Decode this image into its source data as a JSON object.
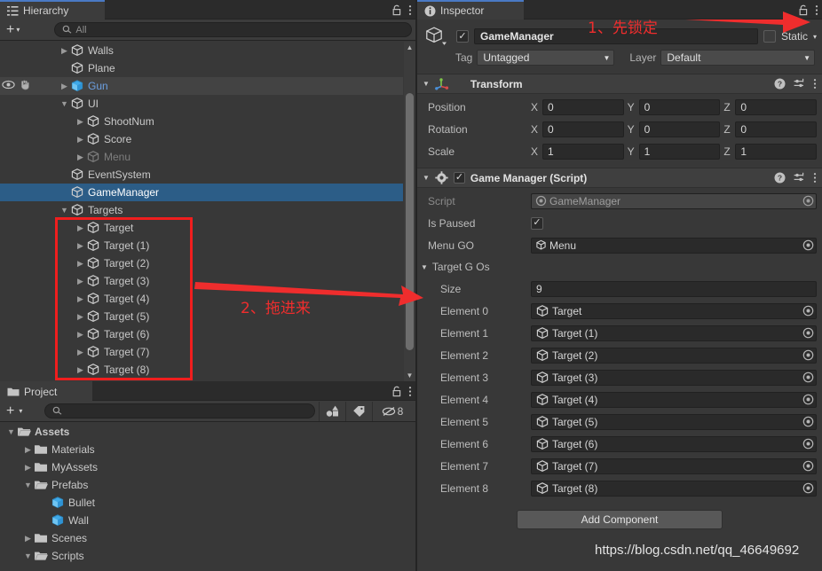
{
  "hierarchy": {
    "tab_label": "Hierarchy",
    "tab_icon": "hierarchy-icon",
    "lock_icon": "lock-icon",
    "menu_icon": "kebab-menu-icon",
    "create_label": "+",
    "create_caret": "▾",
    "search_placeholder": "All",
    "search_value": "",
    "search_icon": "search-icon",
    "items": [
      {
        "label": "Walls",
        "depth": 2,
        "arrow": "▶",
        "state": "normal",
        "icon": "cube-icon"
      },
      {
        "label": "Plane",
        "depth": 2,
        "arrow": "",
        "state": "normal",
        "icon": "cube-icon"
      },
      {
        "label": "Gun",
        "depth": 2,
        "arrow": "▶",
        "state": "hover-prefab",
        "icon": "prefab-cube-icon",
        "eye_icon": "eye-icon",
        "hand_icon": "hand-icon"
      },
      {
        "label": "UI",
        "depth": 2,
        "arrow": "▼",
        "state": "normal",
        "icon": "cube-icon"
      },
      {
        "label": "ShootNum",
        "depth": 3,
        "arrow": "▶",
        "state": "normal",
        "icon": "cube-icon"
      },
      {
        "label": "Score",
        "depth": 3,
        "arrow": "▶",
        "state": "normal",
        "icon": "cube-icon"
      },
      {
        "label": "Menu",
        "depth": 3,
        "arrow": "▶",
        "state": "disabled",
        "icon": "cube-icon"
      },
      {
        "label": "EventSystem",
        "depth": 2,
        "arrow": "",
        "state": "normal",
        "icon": "cube-icon"
      },
      {
        "label": "GameManager",
        "depth": 2,
        "arrow": "",
        "state": "selected",
        "icon": "cube-icon"
      },
      {
        "label": "Targets",
        "depth": 2,
        "arrow": "▼",
        "state": "normal",
        "icon": "cube-icon"
      },
      {
        "label": "Target",
        "depth": 3,
        "arrow": "▶",
        "state": "normal",
        "icon": "cube-icon"
      },
      {
        "label": "Target (1)",
        "depth": 3,
        "arrow": "▶",
        "state": "normal",
        "icon": "cube-icon"
      },
      {
        "label": "Target (2)",
        "depth": 3,
        "arrow": "▶",
        "state": "normal",
        "icon": "cube-icon"
      },
      {
        "label": "Target (3)",
        "depth": 3,
        "arrow": "▶",
        "state": "normal",
        "icon": "cube-icon"
      },
      {
        "label": "Target (4)",
        "depth": 3,
        "arrow": "▶",
        "state": "normal",
        "icon": "cube-icon"
      },
      {
        "label": "Target (5)",
        "depth": 3,
        "arrow": "▶",
        "state": "normal",
        "icon": "cube-icon"
      },
      {
        "label": "Target (6)",
        "depth": 3,
        "arrow": "▶",
        "state": "normal",
        "icon": "cube-icon"
      },
      {
        "label": "Target (7)",
        "depth": 3,
        "arrow": "▶",
        "state": "normal",
        "icon": "cube-icon"
      },
      {
        "label": "Target (8)",
        "depth": 3,
        "arrow": "▶",
        "state": "normal",
        "icon": "cube-icon"
      }
    ]
  },
  "project": {
    "tab_label": "Project",
    "tab_icon": "folder-icon",
    "lock_icon": "lock-icon",
    "menu_icon": "kebab-menu-icon",
    "create_label": "+",
    "create_caret": "▾",
    "search_placeholder": "",
    "search_value": "",
    "search_icon": "search-icon",
    "filter_type_icon": "filter-by-type-icon",
    "filter_label_icon": "filter-by-label-icon",
    "hidden_icon": "hidden-objects-icon",
    "hidden_count": "8",
    "items": [
      {
        "label": "Assets",
        "depth": 0,
        "arrow": "▼",
        "icon": "folder-open-icon",
        "bold": true
      },
      {
        "label": "Materials",
        "depth": 1,
        "arrow": "▶",
        "icon": "folder-icon",
        "bold": false
      },
      {
        "label": "MyAssets",
        "depth": 1,
        "arrow": "▶",
        "icon": "folder-icon",
        "bold": false
      },
      {
        "label": "Prefabs",
        "depth": 1,
        "arrow": "▼",
        "icon": "folder-open-icon",
        "bold": false
      },
      {
        "label": "Bullet",
        "depth": 2,
        "arrow": "",
        "icon": "prefab-cube-icon",
        "bold": false
      },
      {
        "label": "Wall",
        "depth": 2,
        "arrow": "",
        "icon": "prefab-cube-icon",
        "bold": false
      },
      {
        "label": "Scenes",
        "depth": 1,
        "arrow": "▶",
        "icon": "folder-icon",
        "bold": false
      },
      {
        "label": "Scripts",
        "depth": 1,
        "arrow": "▼",
        "icon": "folder-open-icon",
        "bold": false
      }
    ]
  },
  "inspector": {
    "tab_label": "Inspector",
    "tab_icon": "info-icon",
    "lock_icon": "lock-icon",
    "menu_icon": "kebab-menu-icon",
    "object_icon": "gameobject-cube-icon",
    "active_checked": true,
    "object_name": "GameManager",
    "static_checked": false,
    "static_label": "Static",
    "static_caret": "▾",
    "tag_label": "Tag",
    "tag_value": "Untagged",
    "layer_label": "Layer",
    "layer_value": "Default",
    "transform": {
      "title": "Transform",
      "icon": "transform-axis-icon",
      "help_icon": "help-icon",
      "preset_icon": "preset-icon",
      "menu_icon": "kebab-menu-icon",
      "expanded_caret": "▼",
      "rows": [
        {
          "label": "Position",
          "x": "0",
          "y": "0",
          "z": "0"
        },
        {
          "label": "Rotation",
          "x": "0",
          "y": "0",
          "z": "0"
        },
        {
          "label": "Scale",
          "x": "1",
          "y": "1",
          "z": "1"
        }
      ],
      "axis_labels": [
        "X",
        "Y",
        "Z"
      ]
    },
    "script_component": {
      "title": "Game Manager (Script)",
      "icon": "script-gear-icon",
      "enabled_checked": true,
      "help_icon": "help-icon",
      "preset_icon": "preset-icon",
      "menu_icon": "kebab-menu-icon",
      "expanded_caret": "▼",
      "script_label": "Script",
      "script_value": "GameManager",
      "script_value_icon": "cs-script-icon",
      "is_paused_label": "Is Paused",
      "is_paused_checked": true,
      "menu_go_label": "Menu GO",
      "menu_go_value": "Menu",
      "menu_go_icon": "cube-icon",
      "array_label": "Target G Os",
      "array_caret": "▼",
      "size_label": "Size",
      "size_value": "9",
      "elements": [
        {
          "label": "Element 0",
          "value": "Target",
          "icon": "cube-icon"
        },
        {
          "label": "Element 1",
          "value": "Target (1)",
          "icon": "cube-icon"
        },
        {
          "label": "Element 2",
          "value": "Target (2)",
          "icon": "cube-icon"
        },
        {
          "label": "Element 3",
          "value": "Target (3)",
          "icon": "cube-icon"
        },
        {
          "label": "Element 4",
          "value": "Target (4)",
          "icon": "cube-icon"
        },
        {
          "label": "Element 5",
          "value": "Target (5)",
          "icon": "cube-icon"
        },
        {
          "label": "Element 6",
          "value": "Target (6)",
          "icon": "cube-icon"
        },
        {
          "label": "Element 7",
          "value": "Target (7)",
          "icon": "cube-icon"
        },
        {
          "label": "Element 8",
          "value": "Target (8)",
          "icon": "cube-icon"
        }
      ]
    },
    "add_component_label": "Add Component"
  },
  "annotations": {
    "step1_text": "1、先锁定",
    "step2_text": "2、拖进来",
    "color": "#ef2d2d"
  },
  "watermark": {
    "text": "https://blog.csdn.net/qq_46649692"
  },
  "colors": {
    "panel_bg": "#383838",
    "tabbar_bg": "#2b2b2b",
    "selection_blue": "#2c5d87",
    "accent_blue": "#4a79c4",
    "annotation_red": "#ef2d2d"
  }
}
